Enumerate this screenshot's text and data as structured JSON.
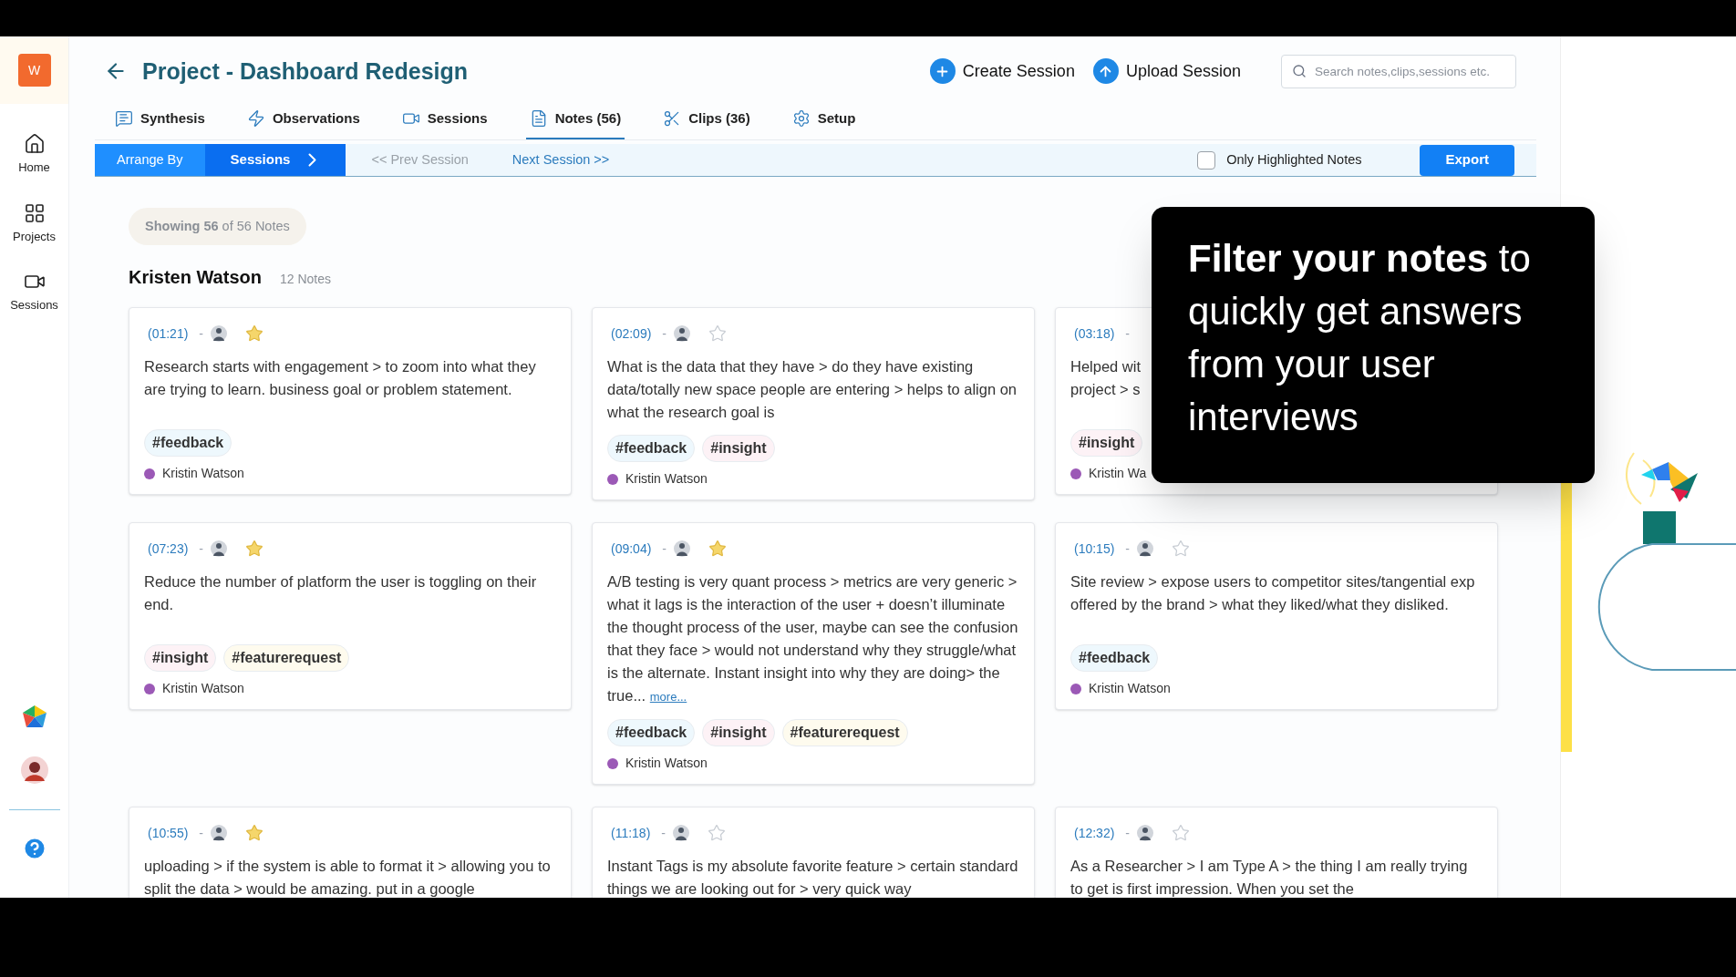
{
  "sidebar": {
    "logo": "W",
    "items": [
      {
        "label": "Home"
      },
      {
        "label": "Projects"
      },
      {
        "label": "Sessions"
      }
    ]
  },
  "header": {
    "title": "Project - Dashboard Redesign",
    "actions": [
      {
        "label": "Create Session"
      },
      {
        "label": "Upload Session"
      }
    ],
    "search": {
      "placeholder": "Search notes,clips,sessions etc."
    }
  },
  "tabs": [
    {
      "label": "Synthesis",
      "selected": false
    },
    {
      "label": "Observations",
      "selected": false
    },
    {
      "label": "Sessions",
      "selected": false
    },
    {
      "label": "Notes (56)",
      "selected": true
    },
    {
      "label": "Clips (36)",
      "selected": false
    },
    {
      "label": "Setup",
      "selected": false
    }
  ],
  "toolbar": {
    "arrange_label": "Arrange By",
    "arrange_value": "Sessions",
    "prev": {
      "label": "<< Prev Session",
      "disabled": true
    },
    "next": {
      "label": "Next Session >>",
      "disabled": false
    },
    "filter": {
      "label": "Only Highlighted Notes",
      "checked": false
    },
    "export": "Export"
  },
  "summary": "**Showing 56** of 56 Notes",
  "group": {
    "name": "Kristen Watson",
    "count": "12 Notes"
  },
  "notes": [
    {
      "time": "(01:21)",
      "separator": "-",
      "starred": true,
      "text": [
        "Research starts with engagement > to zoom into what they are trying to learn. business goal or problem statement."
      ],
      "tags": [
        {
          "label": "#feedback",
          "color": "#eef8fd"
        }
      ],
      "author": "Kristin Watson"
    },
    {
      "time": "(02:09)",
      "separator": "-",
      "starred": false,
      "text": [
        "What is the data that they have > do they have existing data/totally new space people are entering > helps to align on what the research goal is"
      ],
      "tags": [
        {
          "label": "#feedback",
          "color": "#eef8fd"
        },
        {
          "label": "#insight",
          "color": "#fdf2f6"
        }
      ],
      "author": "Kristin Watson"
    },
    {
      "time": "(03:18)",
      "separator": "-",
      "text": [
        "Helped wit",
        "project > s"
      ],
      "tags": [
        {
          "label": "#insight",
          "color": "#fdf2f6"
        }
      ],
      "author": "Kristin Wa"
    },
    {
      "time": "(07:23)",
      "separator": "-",
      "starred": true,
      "text": [
        "Reduce the number of platform the user is toggling on their end."
      ],
      "tags": [
        {
          "label": "#insight",
          "color": "#fdf2f6"
        },
        {
          "label": "#featurerequest",
          "color": "#fefbee"
        }
      ],
      "author": "Kristin Watson"
    },
    {
      "time": "(09:04)",
      "separator": "-",
      "starred": true,
      "text": [
        "A/B testing is very quant process > metrics are very generic > what it lags is the interaction of the user + doesn’t illuminate the thought process of the user, maybe can see the confusion that they face > would not understand why they struggle/what is the alternate. Instant insight into why they are doing> the true..."
      ],
      "more": "more...",
      "tags": [
        {
          "label": "#feedback",
          "color": "#eef8fd"
        },
        {
          "label": "#insight",
          "color": "#fdf2f6"
        },
        {
          "label": "#featurerequest",
          "color": "#fefbee"
        }
      ],
      "author": "Kristin Watson"
    },
    {
      "time": "(10:15)",
      "separator": "-",
      "starred": false,
      "text": [
        "Site review > expose users to competitor sites/tangential exp offered by the brand > what they liked/what they disliked."
      ],
      "tags": [
        {
          "label": "#feedback",
          "color": "#eef8fd"
        }
      ],
      "author": "Kristin Watson"
    },
    {
      "time": "(10:55)",
      "separator": "-",
      "starred": true,
      "text": [
        "uploading > if the system is able to format it > allowing you to split the data > would be amazing. put in a google"
      ]
    },
    {
      "time": "(11:18)",
      "separator": "-",
      "starred": false,
      "text": [
        "Instant Tags is my absolute favorite feature > certain standard things we are looking out for > very quick way"
      ]
    },
    {
      "time": "(12:32)",
      "separator": "-",
      "starred": false,
      "text": [
        "As a Researcher > I am Type A > the thing I am really trying to get is first impression. When you set the"
      ]
    }
  ],
  "callout": "**Filter your notes** to quickly get answers from your user interviews"
}
